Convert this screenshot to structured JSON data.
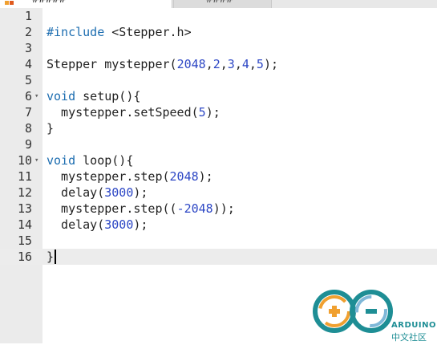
{
  "tabs": [
    {
      "label": "#####"
    },
    {
      "label": "####"
    }
  ],
  "editor": {
    "lines": [
      {
        "n": "1",
        "text": ""
      },
      {
        "n": "2",
        "text": "#include <Stepper.h>"
      },
      {
        "n": "3",
        "text": ""
      },
      {
        "n": "4",
        "text": "Stepper mystepper(2048,2,3,4,5);"
      },
      {
        "n": "5",
        "text": ""
      },
      {
        "n": "6",
        "text": "void setup(){"
      },
      {
        "n": "7",
        "text": "  mystepper.setSpeed(5);"
      },
      {
        "n": "8",
        "text": "}"
      },
      {
        "n": "9",
        "text": ""
      },
      {
        "n": "10",
        "text": "void loop(){"
      },
      {
        "n": "11",
        "text": "  mystepper.step(2048);"
      },
      {
        "n": "12",
        "text": "  delay(3000);"
      },
      {
        "n": "13",
        "text": "  mystepper.step((-2048));"
      },
      {
        "n": "14",
        "text": "  delay(3000);"
      },
      {
        "n": "15",
        "text": ""
      },
      {
        "n": "16",
        "text": "}"
      }
    ],
    "fold_markers": [
      "6",
      "10"
    ],
    "active_line": "16",
    "colors": {
      "keyword": "#1c6db0",
      "number": "#2d47c5",
      "gutter": "#ebebeb",
      "active_line": "#ececec"
    }
  },
  "watermark": {
    "brand": "ARDUINO",
    "sub": "中文社区"
  },
  "icons": {
    "tab": "sketch-icon",
    "fold": "fold-arrow-icon",
    "logo": "arduino-infinity-logo"
  }
}
